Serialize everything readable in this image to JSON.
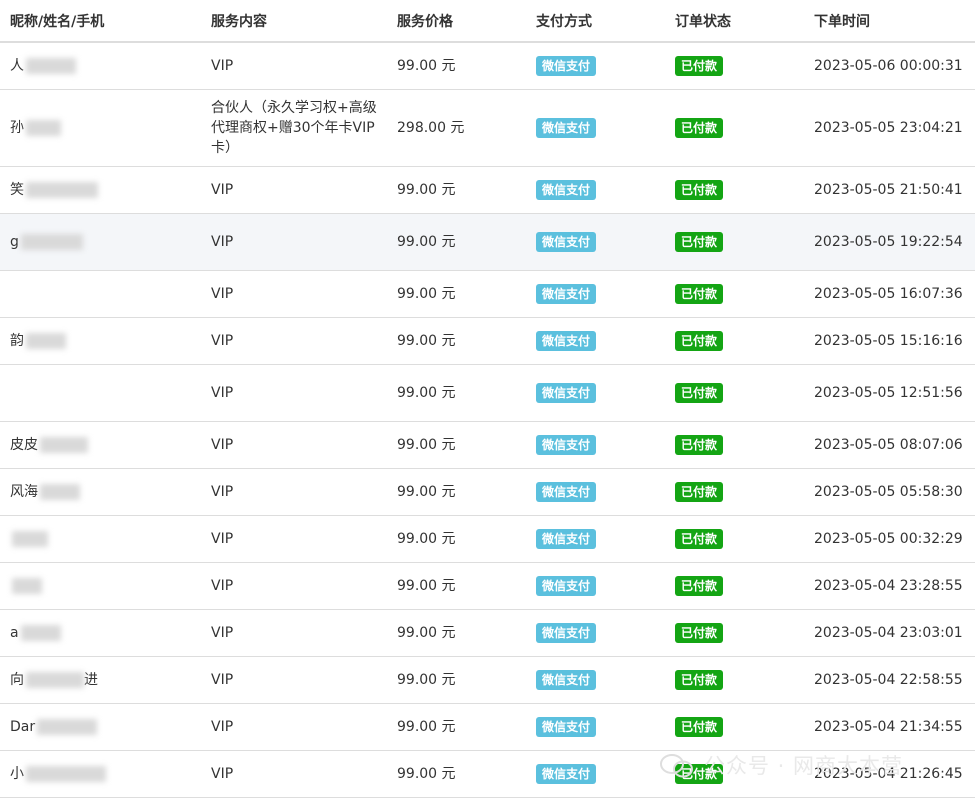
{
  "headers": [
    "昵称/姓名/手机",
    "服务内容",
    "服务价格",
    "支付方式",
    "订单状态",
    "下单时间"
  ],
  "rows": [
    {
      "name": "人",
      "service": "VIP",
      "price": "99.00 元",
      "pay": "微信支付",
      "status": "已付款",
      "time": "2023-05-06 00:00:31"
    },
    {
      "name": "孙",
      "service": "合伙人（永久学习权+高级代理商权+赠30个年卡VIP卡）",
      "price": "298.00 元",
      "pay": "微信支付",
      "status": "已付款",
      "time": "2023-05-05 23:04:21"
    },
    {
      "name": "笑",
      "service": "VIP",
      "price": "99.00 元",
      "pay": "微信支付",
      "status": "已付款",
      "time": "2023-05-05 21:50:41"
    },
    {
      "name": "g",
      "service": "VIP",
      "price": "99.00 元",
      "pay": "微信支付",
      "status": "已付款",
      "time": "2023-05-05 19:22:54"
    },
    {
      "name": "",
      "service": "VIP",
      "price": "99.00 元",
      "pay": "微信支付",
      "status": "已付款",
      "time": "2023-05-05 16:07:36"
    },
    {
      "name": "韵",
      "service": "VIP",
      "price": "99.00 元",
      "pay": "微信支付",
      "status": "已付款",
      "time": "2023-05-05 15:16:16"
    },
    {
      "name": "",
      "service": "VIP",
      "price": "99.00 元",
      "pay": "微信支付",
      "status": "已付款",
      "time": "2023-05-05 12:51:56"
    },
    {
      "name": "皮皮",
      "service": "VIP",
      "price": "99.00 元",
      "pay": "微信支付",
      "status": "已付款",
      "time": "2023-05-05 08:07:06"
    },
    {
      "name": "风海",
      "service": "VIP",
      "price": "99.00 元",
      "pay": "微信支付",
      "status": "已付款",
      "time": "2023-05-05 05:58:30"
    },
    {
      "name": "",
      "service": "VIP",
      "price": "99.00 元",
      "pay": "微信支付",
      "status": "已付款",
      "time": "2023-05-05 00:32:29"
    },
    {
      "name": "",
      "service": "VIP",
      "price": "99.00 元",
      "pay": "微信支付",
      "status": "已付款",
      "time": "2023-05-04 23:28:55"
    },
    {
      "name": "a",
      "service": "VIP",
      "price": "99.00 元",
      "pay": "微信支付",
      "status": "已付款",
      "time": "2023-05-04 23:03:01"
    },
    {
      "name": "向",
      "name_suffix": "进",
      "service": "VIP",
      "price": "99.00 元",
      "pay": "微信支付",
      "status": "已付款",
      "time": "2023-05-04 22:58:55"
    },
    {
      "name": "Dar",
      "service": "VIP",
      "price": "99.00 元",
      "pay": "微信支付",
      "status": "已付款",
      "time": "2023-05-04 21:34:55"
    },
    {
      "name": "小",
      "service": "VIP",
      "price": "99.00 元",
      "pay": "微信支付",
      "status": "已付款",
      "time": "2023-05-04 21:26:45"
    }
  ],
  "watermark": "公众号 · 网商大本营",
  "colors": {
    "pay_badge": "#5bc0de",
    "paid_badge": "#14a514",
    "row_border": "#dddddd",
    "highlight_row": "#f4f6f9"
  }
}
